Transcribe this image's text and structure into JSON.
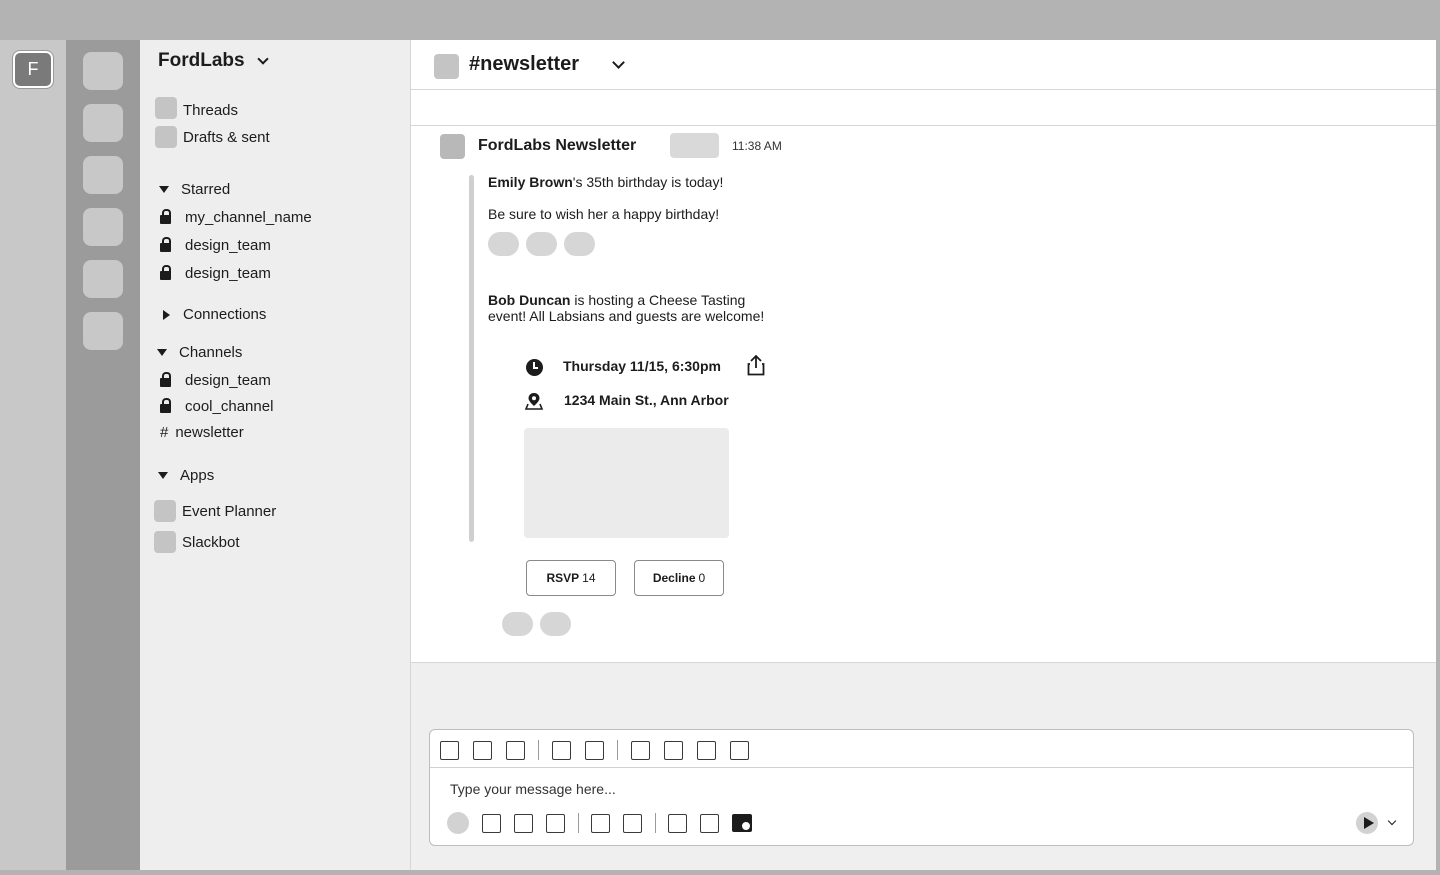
{
  "workspace": {
    "initial": "F",
    "name": "FordLabs"
  },
  "sidebar": {
    "top_items": [
      {
        "label": "Threads"
      },
      {
        "label": "Drafts & sent"
      }
    ],
    "starred": {
      "label": "Starred",
      "items": [
        "my_channel_name",
        "design_team",
        "design_team"
      ]
    },
    "connections": {
      "label": "Connections"
    },
    "channels": {
      "label": "Channels",
      "items": [
        "design_team",
        "cool_channel"
      ],
      "public_item": "newsletter",
      "hash": "#"
    },
    "apps": {
      "label": "Apps",
      "items": [
        "Event Planner",
        "Slackbot"
      ]
    }
  },
  "channel": {
    "title": "#newsletter"
  },
  "message": {
    "author": "FordLabs Newsletter",
    "time": "11:38 AM",
    "birthday": {
      "name": "Emily Brown",
      "text": "'s 35th birthday is today!",
      "wish": "Be sure to wish her a happy birthday!"
    },
    "event": {
      "host": "Bob Duncan",
      "text_line1": " is hosting a Cheese Tasting",
      "text_line2": "event! All Labsians and guests are welcome!",
      "datetime": "Thursday 11/15, 6:30pm",
      "location": "1234 Main St., Ann Arbor",
      "rsvp_label": "RSVP",
      "rsvp_count": "14",
      "decline_label": "Decline",
      "decline_count": "0"
    }
  },
  "composer": {
    "placeholder": "Type your message here..."
  },
  "icons": {
    "clock": "clock-icon",
    "share": "share-icon",
    "location": "map-pin-icon",
    "send": "send-icon",
    "media": "media-icon"
  }
}
